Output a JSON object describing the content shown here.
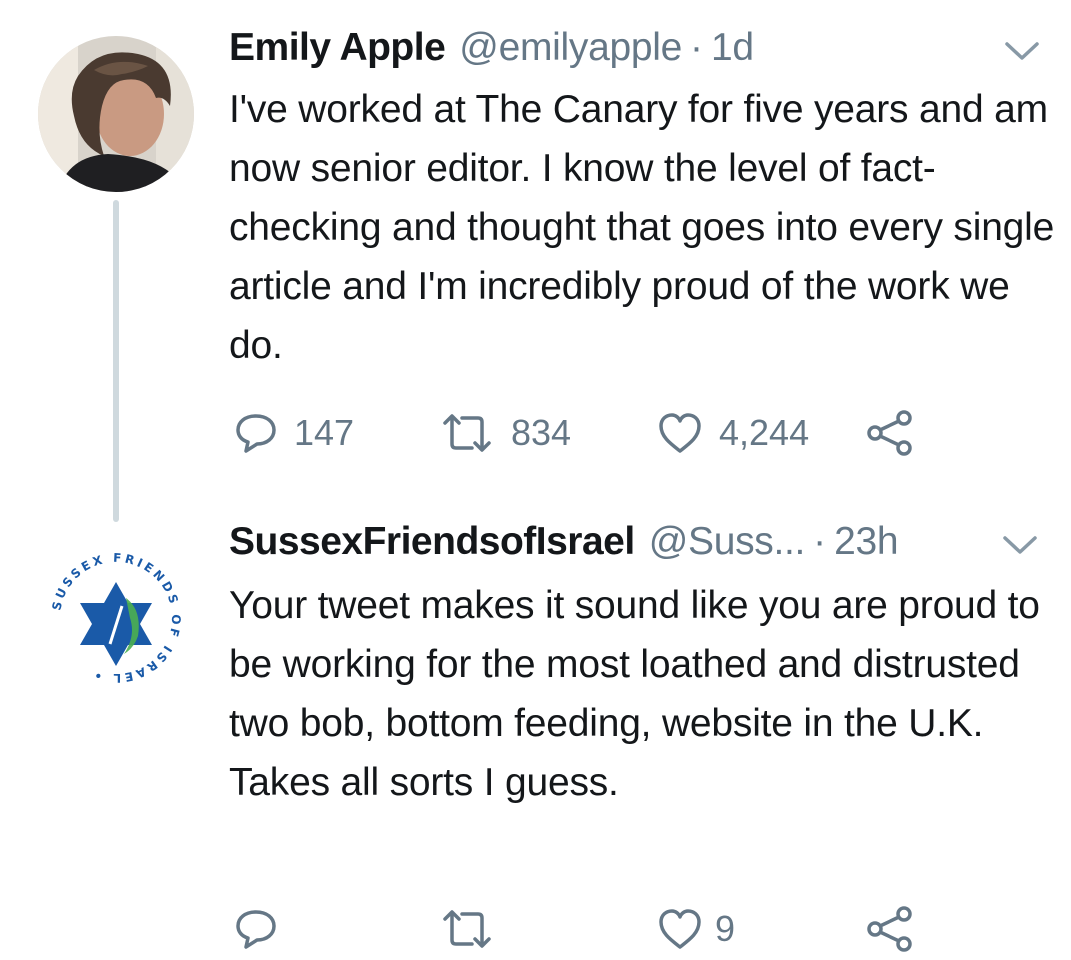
{
  "tweets": [
    {
      "name": "Emily Apple",
      "handle": "@emilyapple",
      "separator": "·",
      "time": "1d",
      "text": "I've worked at The Canary for five years and am now senior editor. I know the level of fact-checking and thought that goes into every single article and I'm incredibly proud of the work we do.",
      "replies": "147",
      "retweets": "834",
      "likes": "4,244"
    },
    {
      "name": "SussexFriendsofIsrael",
      "handle": "@Suss...",
      "separator": "·",
      "time": "23h",
      "text": "Your tweet makes it sound like you are proud to be working for the most loathed and distrusted two bob, bottom feeding, website in the U.K.  Takes all sorts I guess.",
      "replies": "",
      "retweets": "",
      "likes": "9",
      "avatar_logo_text": "SUSSEX FRIENDS OF ISRAEL"
    }
  ],
  "colors": {
    "text": "#14171a",
    "secondary": "#657786",
    "thread_line": "#cfd9de",
    "logo_blue": "#1a5aa8",
    "logo_green": "#4caf50"
  },
  "icons": [
    "reply-icon",
    "retweet-icon",
    "like-icon",
    "share-icon",
    "chevron-down-icon"
  ]
}
